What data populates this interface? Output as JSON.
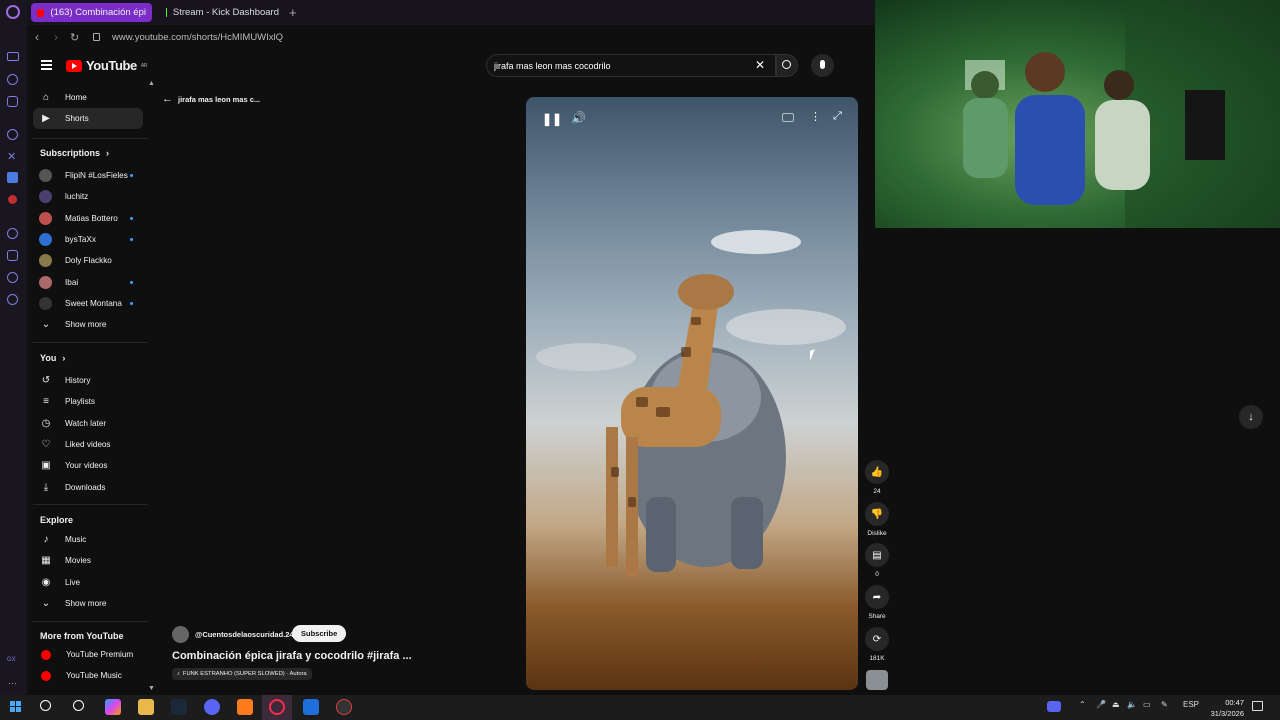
{
  "browser": {
    "tabs": [
      {
        "label": "(163) Combinación épi",
        "active": true
      },
      {
        "label": "Stream - Kick Dashboard",
        "active": false
      }
    ],
    "new_tab": "+",
    "url": "www.youtube.com/shorts/HcMIMUWIxlQ"
  },
  "youtube": {
    "logo_text": "YouTube",
    "logo_sup": "AR",
    "search_value": "jirafa mas leon mas cocodrilo",
    "back_label": "jirafa mas leon mas c...",
    "sidebar": {
      "main": [
        {
          "label": "Home",
          "icon": "home-icon"
        },
        {
          "label": "Shorts",
          "icon": "shorts-icon",
          "active": true
        }
      ],
      "subscriptions_title": "Subscriptions",
      "subscriptions": [
        {
          "label": "FlipiN #LosFieles",
          "dot": true,
          "color": "#555555"
        },
        {
          "label": "luchitz",
          "dot": false,
          "color": "#4a4070"
        },
        {
          "label": "Matias Bottero",
          "dot": true,
          "color": "#c05050"
        },
        {
          "label": "bysTaXx",
          "dot": true,
          "color": "#2e6fd1"
        },
        {
          "label": "Doly Flackko",
          "dot": false,
          "color": "#8a7a4a"
        },
        {
          "label": "Ibai",
          "dot": true,
          "color": "#aa6a6a"
        },
        {
          "label": "Sweet Montana",
          "dot": true,
          "color": "#333333"
        }
      ],
      "show_more_1": "Show more",
      "you_title": "You",
      "you_items": [
        {
          "label": "History",
          "icon": "history-icon"
        },
        {
          "label": "Playlists",
          "icon": "playlists-icon"
        },
        {
          "label": "Watch later",
          "icon": "watch-later-icon"
        },
        {
          "label": "Liked videos",
          "icon": "like-icon"
        },
        {
          "label": "Your videos",
          "icon": "your-videos-icon"
        },
        {
          "label": "Downloads",
          "icon": "download-icon"
        }
      ],
      "explore_title": "Explore",
      "explore_items": [
        {
          "label": "Music",
          "icon": "music-icon"
        },
        {
          "label": "Movies",
          "icon": "movies-icon"
        },
        {
          "label": "Live",
          "icon": "live-icon"
        }
      ],
      "show_more_2": "Show more",
      "more_title": "More from YouTube",
      "more_items": [
        {
          "label": "YouTube Premium"
        },
        {
          "label": "YouTube Music"
        }
      ]
    },
    "short": {
      "channel": "@Cuentosdelaoscuridad.24",
      "subscribe": "Subscribe",
      "title": "Combinación épica jirafa y cocodrilo #jirafa ...",
      "sound": "FUNK ESTRANHO (SUPER SLOWED) · Autora"
    },
    "actions": {
      "likes": "24",
      "dislike": "Dislike",
      "comments": "0",
      "share": "Share",
      "remix": "181K"
    }
  },
  "taskbar": {
    "language": "ESP",
    "time": "00:47",
    "date": "31/3/2026"
  },
  "colors": {
    "brand_red": "#ff0000",
    "tab_active": "#7b2ec7",
    "kick_green": "#53fc18"
  }
}
